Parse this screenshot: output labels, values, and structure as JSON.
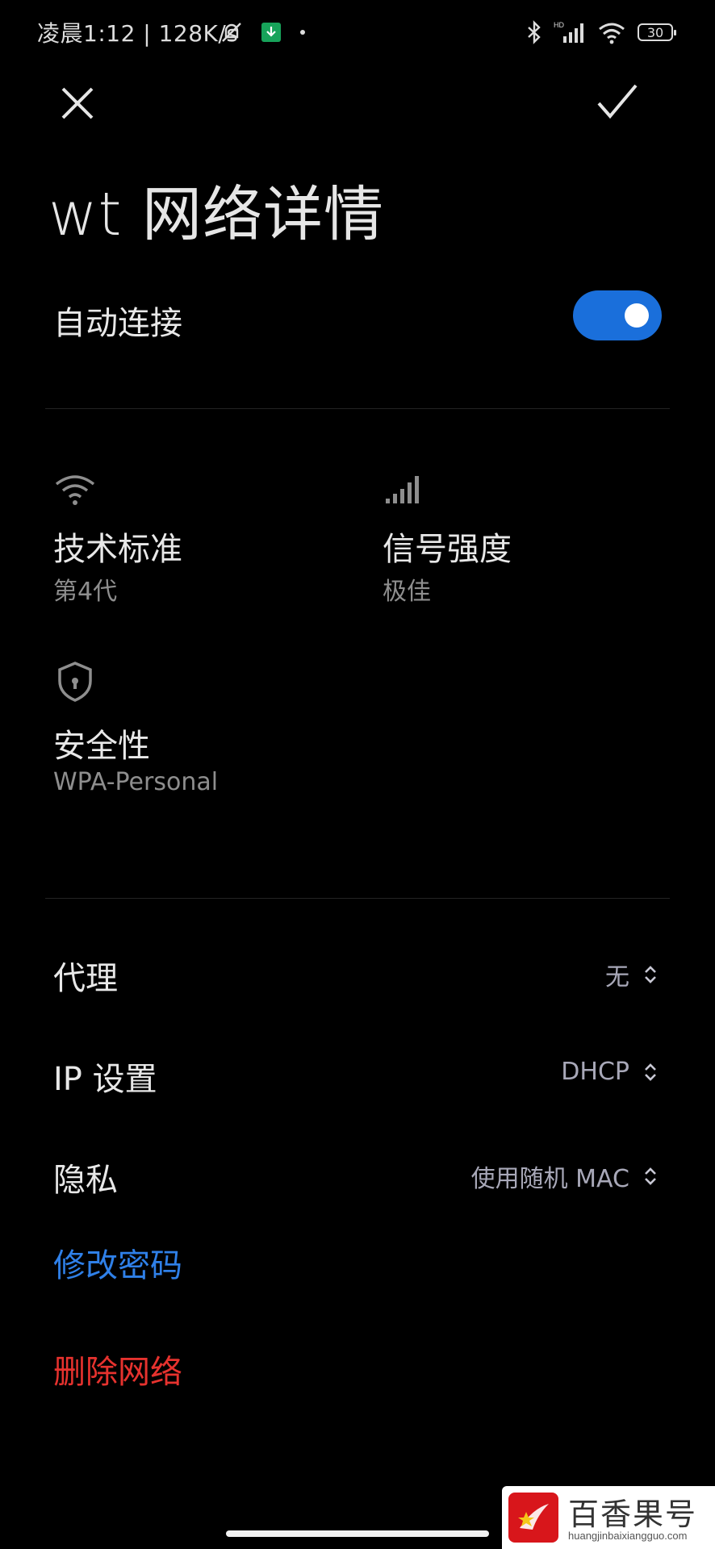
{
  "status_bar": {
    "time_speed": "凌晨1:12 | 128K/s",
    "battery": "30",
    "icons": [
      "mute-bell-icon",
      "download-icon",
      "dot-icon",
      "bluetooth-icon",
      "hd-signal-icon",
      "wifi-icon",
      "battery-icon"
    ]
  },
  "header": {
    "title": "wt 网络详情",
    "close_icon": "close-icon",
    "confirm_icon": "check-icon"
  },
  "auto_connect": {
    "label": "自动连接",
    "enabled": true,
    "accent": "#1a6fdb"
  },
  "info": {
    "tech": {
      "title": "技术标准",
      "value": "第4代",
      "icon": "wifi-icon"
    },
    "signal": {
      "title": "信号强度",
      "value": "极佳",
      "icon": "signal-bars-icon"
    },
    "security": {
      "title": "安全性",
      "value": "WPA-Personal",
      "icon": "shield-icon"
    }
  },
  "settings": {
    "proxy": {
      "label": "代理",
      "value": "无"
    },
    "ip": {
      "label": "IP 设置",
      "value": "DHCP"
    },
    "privacy": {
      "label": "隐私",
      "value": "使用随机 MAC"
    }
  },
  "actions": {
    "change_password": "修改密码",
    "delete_network": "删除网络",
    "blue": "#2f80e8",
    "red": "#e6322e"
  },
  "watermark": {
    "name": "百香果号",
    "url": "huangjinbaixiangguo.com"
  }
}
